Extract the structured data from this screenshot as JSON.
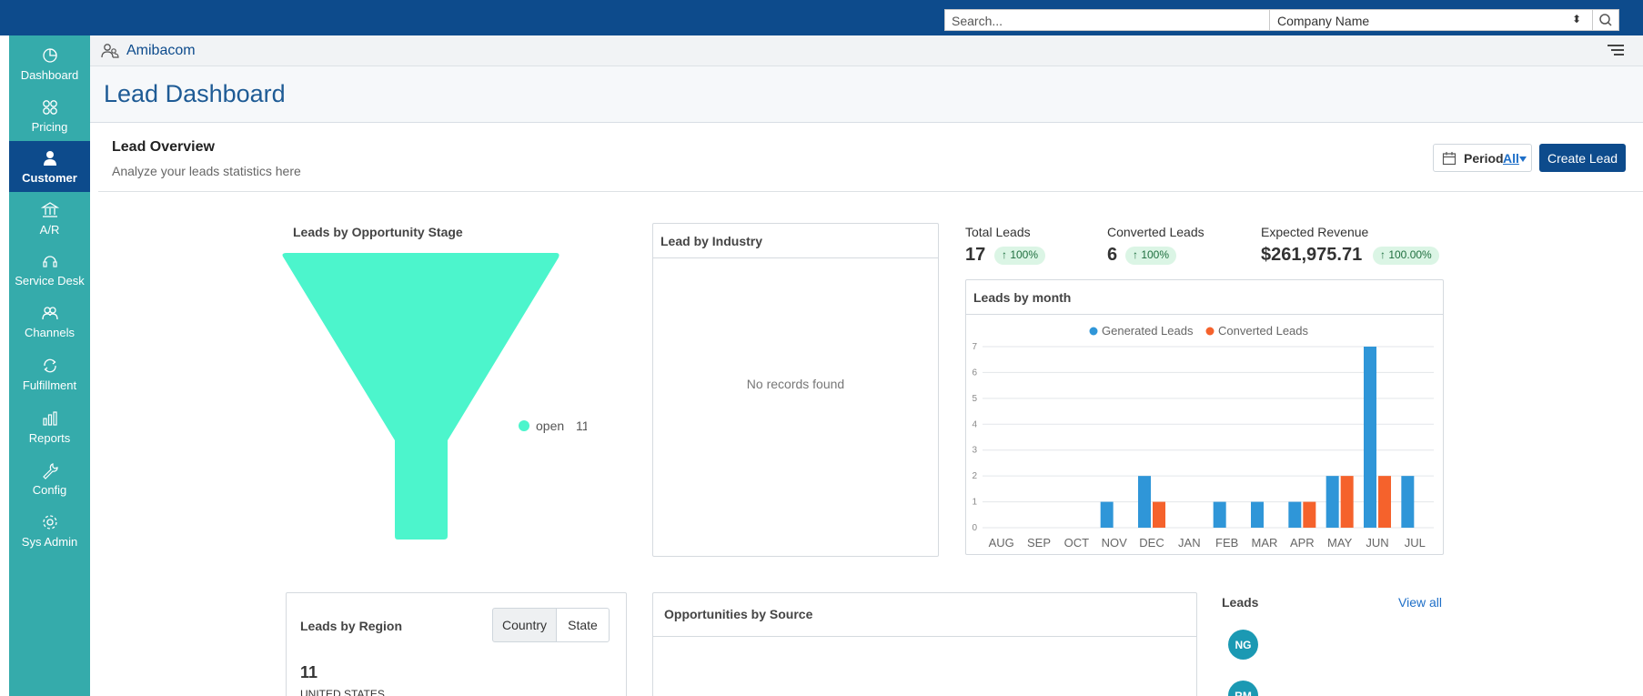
{
  "topbar": {
    "search_placeholder": "Search...",
    "company_select": "Company Name",
    "select_arrows": "⬍"
  },
  "sidebar": {
    "items": [
      {
        "label": "Dashboard",
        "icon": "dashboard-icon",
        "active": false
      },
      {
        "label": "Pricing",
        "icon": "pricing-icon",
        "active": false
      },
      {
        "label": "Customer",
        "icon": "customer-icon",
        "active": true
      },
      {
        "label": "A/R",
        "icon": "bank-icon",
        "active": false
      },
      {
        "label": "Service Desk",
        "icon": "headset-icon",
        "active": false
      },
      {
        "label": "Channels",
        "icon": "channels-icon",
        "active": false
      },
      {
        "label": "Fulfillment",
        "icon": "fulfillment-icon",
        "active": false
      },
      {
        "label": "Reports",
        "icon": "reports-icon",
        "active": false
      },
      {
        "label": "Config",
        "icon": "wrench-icon",
        "active": false
      },
      {
        "label": "Sys Admin",
        "icon": "gear-icon",
        "active": false
      }
    ]
  },
  "breadcrumb": {
    "label": "Amibacom"
  },
  "page": {
    "title": "Lead Dashboard"
  },
  "overview": {
    "title": "Lead Overview",
    "subtitle": "Analyze your leads statistics here",
    "period_label": "Period",
    "period_value": "All",
    "create_label": "Create Lead"
  },
  "funnel": {
    "title": "Leads by Opportunity Stage",
    "legend_label": "open",
    "legend_value": "11"
  },
  "industry": {
    "title": "Lead by Industry",
    "empty_text": "No records found"
  },
  "kpis": [
    {
      "label": "Total Leads",
      "value": "17",
      "change": "↑ 100%"
    },
    {
      "label": "Converted Leads",
      "value": "6",
      "change": "↑ 100%"
    },
    {
      "label": "Expected Revenue",
      "value": "$261,975.71",
      "change": "↑ 100.00%"
    }
  ],
  "month_chart": {
    "title": "Leads by month"
  },
  "region": {
    "title": "Leads by Region",
    "country_label": "Country",
    "state_label": "State",
    "count": "11",
    "country": "UNITED STATES"
  },
  "sources": {
    "title": "Opportunities by Source"
  },
  "leads": {
    "title": "Leads",
    "view_all": "View all",
    "avatars": [
      "NG",
      "RM"
    ]
  },
  "colors": {
    "topbar": "#0d4b8c",
    "sidebar": "#35abab",
    "funnel": "#4cf5cc",
    "generated": "#2f96d8",
    "converted": "#f5622c"
  },
  "chart_data": {
    "type": "bar",
    "categories": [
      "AUG",
      "SEP",
      "OCT",
      "NOV",
      "DEC",
      "JAN",
      "FEB",
      "MAR",
      "APR",
      "MAY",
      "JUN",
      "JUL"
    ],
    "series": [
      {
        "name": "Generated Leads",
        "values": [
          0,
          0,
          0,
          1,
          2,
          0,
          1,
          1,
          1,
          2,
          7,
          2
        ]
      },
      {
        "name": "Converted Leads",
        "values": [
          0,
          0,
          0,
          0,
          1,
          0,
          0,
          0,
          1,
          2,
          2,
          0
        ]
      }
    ],
    "yticks": [
      "0",
      "1",
      "2",
      "3",
      "4",
      "5",
      "6",
      "7"
    ],
    "ylim": [
      0,
      7
    ],
    "legend": "top",
    "grid": true
  }
}
